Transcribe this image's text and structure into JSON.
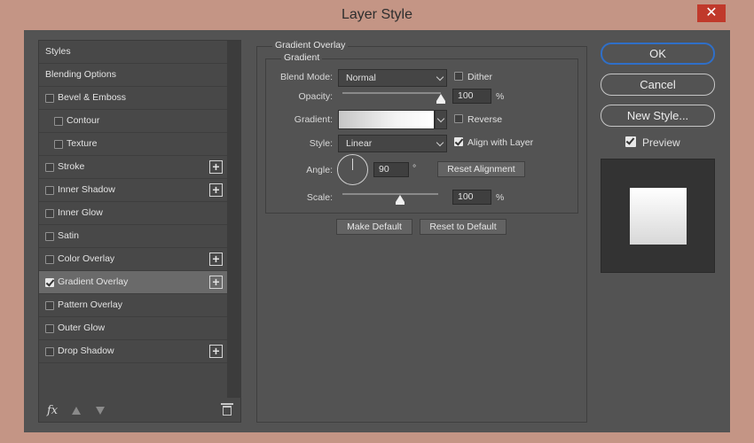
{
  "window": {
    "title": "Layer Style",
    "close_label": "✕"
  },
  "styles_list": {
    "items": [
      {
        "label": "Styles",
        "type": "header",
        "checked": false,
        "plus": false,
        "selected": false
      },
      {
        "label": "Blending Options",
        "type": "header",
        "checked": false,
        "plus": false,
        "selected": false
      },
      {
        "label": "Bevel & Emboss",
        "type": "level1",
        "checked": false,
        "plus": false,
        "selected": false
      },
      {
        "label": "Contour",
        "type": "level2",
        "checked": false,
        "plus": false,
        "selected": false
      },
      {
        "label": "Texture",
        "type": "level2",
        "checked": false,
        "plus": false,
        "selected": false
      },
      {
        "label": "Stroke",
        "type": "level1",
        "checked": false,
        "plus": true,
        "selected": false
      },
      {
        "label": "Inner Shadow",
        "type": "level1",
        "checked": false,
        "plus": true,
        "selected": false
      },
      {
        "label": "Inner Glow",
        "type": "level1",
        "checked": false,
        "plus": false,
        "selected": false
      },
      {
        "label": "Satin",
        "type": "level1",
        "checked": false,
        "plus": false,
        "selected": false
      },
      {
        "label": "Color Overlay",
        "type": "level1",
        "checked": false,
        "plus": true,
        "selected": false
      },
      {
        "label": "Gradient Overlay",
        "type": "level1",
        "checked": true,
        "plus": true,
        "selected": true
      },
      {
        "label": "Pattern Overlay",
        "type": "level1",
        "checked": false,
        "plus": false,
        "selected": false
      },
      {
        "label": "Outer Glow",
        "type": "level1",
        "checked": false,
        "plus": false,
        "selected": false
      },
      {
        "label": "Drop Shadow",
        "type": "level1",
        "checked": false,
        "plus": true,
        "selected": false
      }
    ],
    "footer": {
      "fx_label": "fx"
    }
  },
  "gradient_overlay": {
    "group_title": "Gradient Overlay",
    "subgroup_title": "Gradient",
    "blend_mode": {
      "label": "Blend Mode:",
      "value": "Normal"
    },
    "dither": {
      "label": "Dither",
      "checked": false
    },
    "opacity": {
      "label": "Opacity:",
      "value": "100",
      "unit": "%",
      "fraction": 1.0
    },
    "gradient": {
      "label": "Gradient:"
    },
    "reverse": {
      "label": "Reverse",
      "checked": false
    },
    "style": {
      "label": "Style:",
      "value": "Linear"
    },
    "align_with_layer": {
      "label": "Align with Layer",
      "checked": true
    },
    "angle": {
      "label": "Angle:",
      "value": "90",
      "unit": "°"
    },
    "reset_alignment_label": "Reset Alignment",
    "scale": {
      "label": "Scale:",
      "value": "100",
      "unit": "%",
      "fraction": 0.6
    },
    "make_default_label": "Make Default",
    "reset_to_default_label": "Reset to Default"
  },
  "actions": {
    "ok_label": "OK",
    "cancel_label": "Cancel",
    "new_style_label": "New Style...",
    "preview": {
      "label": "Preview",
      "checked": true
    }
  },
  "colors": {
    "title_bar": "#c49585",
    "panel": "#535353",
    "close": "#c0392b",
    "ok_border": "#2f6fc8"
  }
}
